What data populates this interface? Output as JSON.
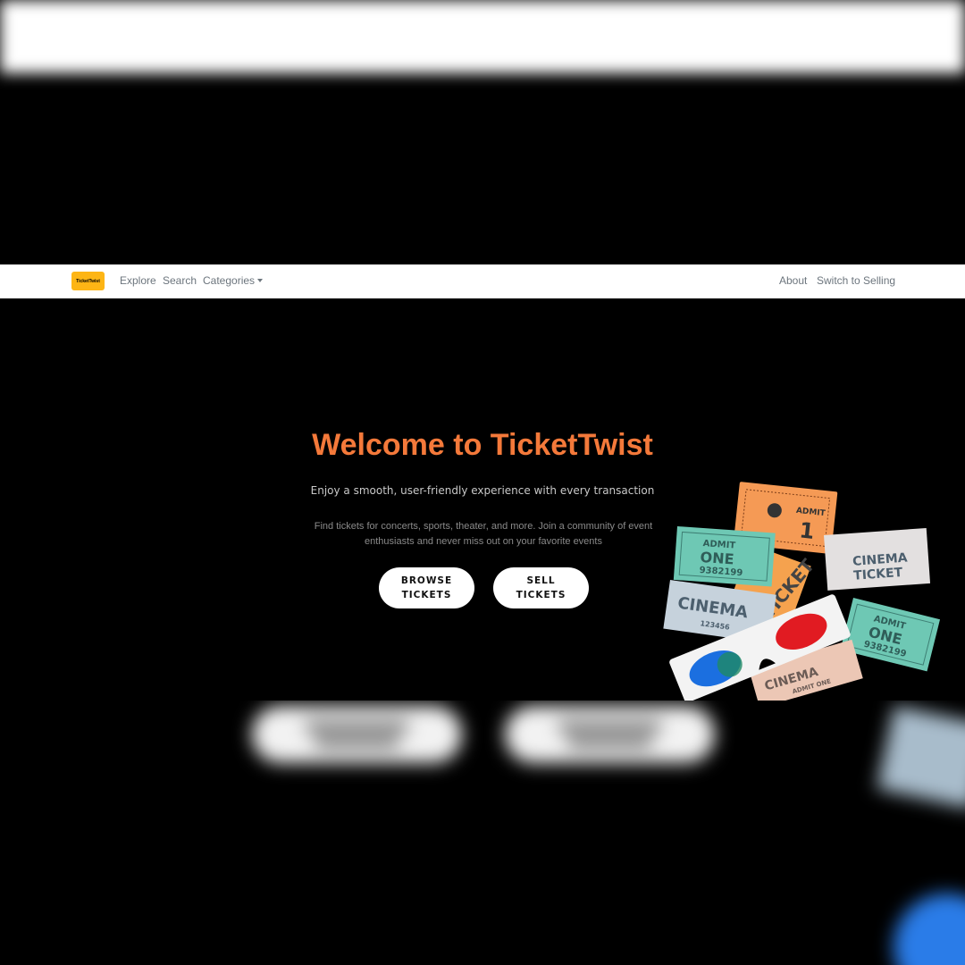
{
  "navbar": {
    "logo_text": "TicketTwist",
    "links": {
      "explore": "Explore",
      "search": "Search",
      "categories": "Categories",
      "about": "About",
      "switch_selling": "Switch to Selling"
    }
  },
  "hero": {
    "title": "Welcome to TicketTwist",
    "subtitle": "Enjoy a smooth, user-friendly experience with every transaction",
    "description": "Find tickets for concerts, sports, theater, and more. Join a community of event enthusiasts and never miss out on your favorite events",
    "browse_button": "BROWSE TICKETS",
    "sell_button": "SELL TICKETS"
  },
  "illustration": {
    "ticket_texts": {
      "admit_one_a": "ADMIT",
      "admit_one_b": "ONE",
      "serial": "9382199",
      "admit_1": "ADMIT",
      "num_1": "1",
      "cinema": "CINEMA",
      "cinema_ticket_a": "CINEMA",
      "cinema_ticket_b": "TICKET",
      "ticket": "TICKET",
      "small_admit": "ADMIT ONE",
      "code": "123456"
    }
  },
  "colors": {
    "accent": "#f4793a",
    "logo_bg": "#fdb515",
    "nav_text": "#6c757d"
  }
}
